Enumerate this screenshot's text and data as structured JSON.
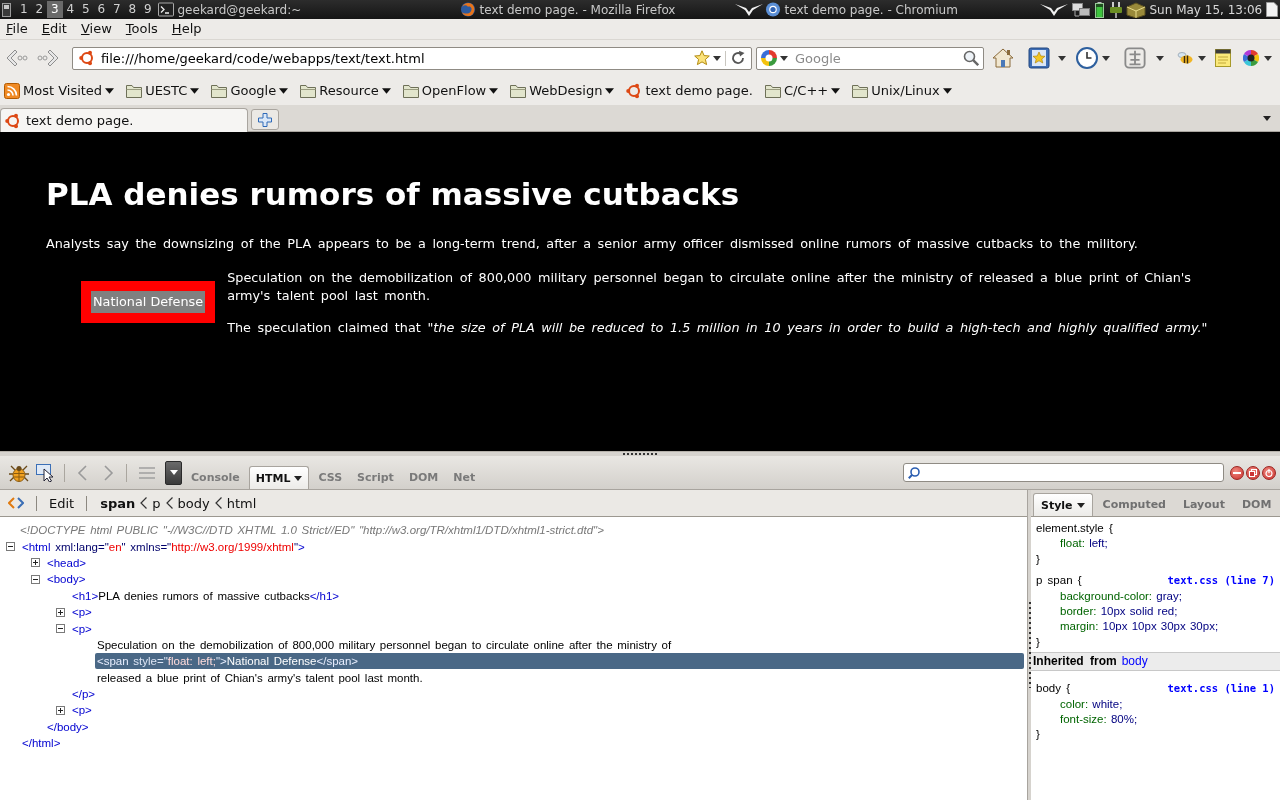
{
  "taskbar": {
    "workspaces": [
      {
        "label": "1",
        "selected": false
      },
      {
        "label": "2",
        "selected": false
      },
      {
        "label": "3",
        "selected": true
      },
      {
        "label": "4",
        "selected": false
      },
      {
        "label": "5",
        "selected": false
      },
      {
        "label": "6",
        "selected": false
      },
      {
        "label": "7",
        "selected": false
      },
      {
        "label": "8",
        "selected": false
      },
      {
        "label": "9",
        "selected": false
      }
    ],
    "tasks": [
      {
        "kind": "terminal",
        "label": "geekard@geekard:~"
      },
      {
        "kind": "firefox",
        "label": "text demo page. - Mozilla Firefox"
      },
      {
        "kind": "chromium",
        "label": "text demo page. - Chromium"
      }
    ],
    "clock": "Sun May 15, 13:06"
  },
  "menu": [
    {
      "label": "File"
    },
    {
      "label": "Edit"
    },
    {
      "label": "View"
    },
    {
      "label": "Tools"
    },
    {
      "label": "Help"
    }
  ],
  "navigation": {
    "address_bar": {
      "value": "file:///home/geekard/code/webapps/text/text.html"
    },
    "search": {
      "placeholder": "Google"
    }
  },
  "bookmarks": [
    {
      "kind": "smart",
      "label": "Most Visited"
    },
    {
      "kind": "folder",
      "label": "UESTC"
    },
    {
      "kind": "folder",
      "label": "Google"
    },
    {
      "kind": "folder",
      "label": "Resource"
    },
    {
      "kind": "folder",
      "label": "OpenFlow"
    },
    {
      "kind": "folder",
      "label": "WebDesign"
    },
    {
      "kind": "page",
      "label": "text demo page."
    },
    {
      "kind": "folder",
      "label": "C/C++"
    },
    {
      "kind": "folder",
      "label": "Unix/Linux"
    }
  ],
  "tabs": [
    {
      "label": "text demo page.",
      "selected": true
    }
  ],
  "page": {
    "heading": "PLA denies rumors of massive cutbacks",
    "intro": "Analysts say the downsizing of the PLA appears to be a long-term trend, after a senior army officer dismissed online rumors of massive cutbacks to the militory.",
    "floated_label": "National Defense",
    "paragraphs": [
      "Speculation on the demobilization of 800,000 military personnel began to circulate online after the ministry of released a blue print of Chian's army's talent pool last month.",
      "The speculation claimed that *\"the size of PLA will be reduced to 1.5 million in 10 years in order to build a high-tech and highly qualified army.\"*"
    ]
  },
  "firebug": {
    "panel_tabs": [
      {
        "label": "Console",
        "selected": false
      },
      {
        "label": "HTML",
        "selected": true
      },
      {
        "label": "CSS",
        "selected": false
      },
      {
        "label": "Script",
        "selected": false
      },
      {
        "label": "DOM",
        "selected": false
      },
      {
        "label": "Net",
        "selected": false
      }
    ],
    "edit_label": "Edit",
    "breadcrumbs": [
      {
        "label": "span",
        "selected": true
      },
      {
        "label": "p",
        "selected": false
      },
      {
        "label": "body",
        "selected": false
      },
      {
        "label": "html",
        "selected": false
      }
    ],
    "side_tabs": [
      {
        "label": "Style",
        "selected": true
      },
      {
        "label": "Computed",
        "selected": false
      },
      {
        "label": "Layout",
        "selected": false
      },
      {
        "label": "DOM",
        "selected": false
      }
    ],
    "html_tree": {
      "doctype": "<!DOCTYPE html PUBLIC \"-//W3C//DTD XHTML 1.0 Strict//ED\" \"http://w3.org/TR/xhtml1/DTD/xhtml1-strict.dtd\">",
      "nodes": [
        {
          "kind": "element",
          "expanded": true,
          "selected": false,
          "open": [
            {
              "kind": "tag",
              "text": "<html"
            },
            {
              "kind": "attr",
              "text": " xml:lang=\""
            },
            {
              "kind": "value",
              "text": "en"
            },
            {
              "kind": "attr",
              "text": "\" xmlns=\""
            },
            {
              "kind": "value",
              "text": "http://w3.org/1999/xhtml"
            },
            {
              "kind": "attr",
              "text": "\""
            },
            {
              "kind": "tag",
              "text": ">"
            }
          ],
          "close": [
            {
              "kind": "tag",
              "text": "</html>"
            }
          ],
          "children": [
            {
              "kind": "element",
              "expanded": false,
              "selected": false,
              "open": [
                {
                  "kind": "tag",
                  "text": "<head>"
                }
              ]
            },
            {
              "kind": "element",
              "expanded": true,
              "selected": false,
              "open": [
                {
                  "kind": "tag",
                  "text": "<body>"
                }
              ],
              "close": [
                {
                  "kind": "tag",
                  "text": "</body>"
                }
              ],
              "children": [
                {
                  "kind": "inline",
                  "selected": false,
                  "tokens": [
                    {
                      "kind": "tag",
                      "text": "<h1>"
                    },
                    {
                      "kind": "text",
                      "text": "PLA denies rumors of massive cutbacks"
                    },
                    {
                      "kind": "tag",
                      "text": "</h1>"
                    }
                  ]
                },
                {
                  "kind": "element",
                  "expanded": false,
                  "selected": false,
                  "open": [
                    {
                      "kind": "tag",
                      "text": "<p>"
                    }
                  ]
                },
                {
                  "kind": "element",
                  "expanded": true,
                  "selected": false,
                  "open": [
                    {
                      "kind": "tag",
                      "text": "<p>"
                    }
                  ],
                  "close": [
                    {
                      "kind": "tag",
                      "text": "</p>"
                    }
                  ],
                  "children": [
                    {
                      "kind": "text",
                      "selected": false,
                      "text": "Speculation on the demobilization of 800,000 military personnel began to circulate online after the ministry of"
                    },
                    {
                      "kind": "inline",
                      "selected": true,
                      "tokens": [
                        {
                          "kind": "tag",
                          "text": "<span"
                        },
                        {
                          "kind": "attr",
                          "text": " style=\""
                        },
                        {
                          "kind": "value",
                          "text": "float: left;"
                        },
                        {
                          "kind": "attr",
                          "text": "\""
                        },
                        {
                          "kind": "tag",
                          "text": ">"
                        },
                        {
                          "kind": "text",
                          "text": "National Defense"
                        },
                        {
                          "kind": "tag",
                          "text": "</span>"
                        }
                      ]
                    },
                    {
                      "kind": "text",
                      "selected": false,
                      "text": "released a blue print of Chian's army's talent pool last month."
                    }
                  ]
                },
                {
                  "kind": "element",
                  "expanded": false,
                  "selected": false,
                  "open": [
                    {
                      "kind": "tag",
                      "text": "<p>"
                    }
                  ]
                }
              ]
            }
          ]
        }
      ]
    },
    "style_sections": [
      {
        "kind": "rule",
        "selector": "element.style {",
        "declarations": [
          {
            "property": "float:",
            "value": "left;"
          }
        ],
        "close": "}"
      },
      {
        "kind": "rule",
        "selector": "p span {",
        "source": "text.css (line 7)",
        "declarations": [
          {
            "property": "background-color:",
            "value": "gray;"
          },
          {
            "property": "border:",
            "value": "10px solid red;"
          },
          {
            "property": "margin:",
            "value": "10px 10px 30px 30px;"
          }
        ],
        "close": "}"
      },
      {
        "kind": "inherited",
        "label": "Inherited from",
        "link": "body"
      },
      {
        "kind": "rule",
        "selector": "body {",
        "source": "text.css (line 1)",
        "declarations": [
          {
            "property": "color:",
            "value": "white;"
          },
          {
            "property": "font-size:",
            "value": "80%;"
          }
        ],
        "close": "}"
      }
    ]
  }
}
